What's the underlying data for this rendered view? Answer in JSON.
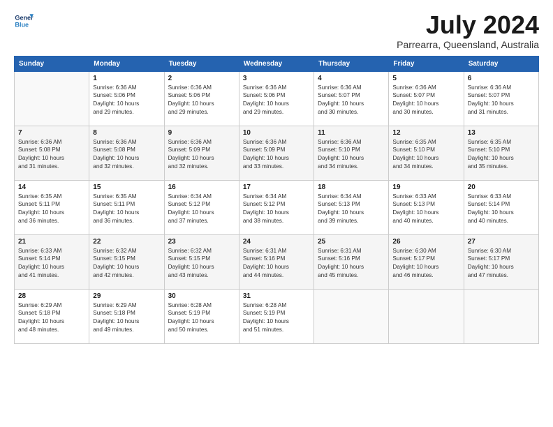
{
  "logo": {
    "line1": "General",
    "line2": "Blue"
  },
  "title": "July 2024",
  "subtitle": "Parrearra, Queensland, Australia",
  "days_header": [
    "Sunday",
    "Monday",
    "Tuesday",
    "Wednesday",
    "Thursday",
    "Friday",
    "Saturday"
  ],
  "weeks": [
    [
      {
        "day": "",
        "info": ""
      },
      {
        "day": "1",
        "info": "Sunrise: 6:36 AM\nSunset: 5:06 PM\nDaylight: 10 hours\nand 29 minutes."
      },
      {
        "day": "2",
        "info": "Sunrise: 6:36 AM\nSunset: 5:06 PM\nDaylight: 10 hours\nand 29 minutes."
      },
      {
        "day": "3",
        "info": "Sunrise: 6:36 AM\nSunset: 5:06 PM\nDaylight: 10 hours\nand 29 minutes."
      },
      {
        "day": "4",
        "info": "Sunrise: 6:36 AM\nSunset: 5:07 PM\nDaylight: 10 hours\nand 30 minutes."
      },
      {
        "day": "5",
        "info": "Sunrise: 6:36 AM\nSunset: 5:07 PM\nDaylight: 10 hours\nand 30 minutes."
      },
      {
        "day": "6",
        "info": "Sunrise: 6:36 AM\nSunset: 5:07 PM\nDaylight: 10 hours\nand 31 minutes."
      }
    ],
    [
      {
        "day": "7",
        "info": "Sunrise: 6:36 AM\nSunset: 5:08 PM\nDaylight: 10 hours\nand 31 minutes."
      },
      {
        "day": "8",
        "info": "Sunrise: 6:36 AM\nSunset: 5:08 PM\nDaylight: 10 hours\nand 32 minutes."
      },
      {
        "day": "9",
        "info": "Sunrise: 6:36 AM\nSunset: 5:09 PM\nDaylight: 10 hours\nand 32 minutes."
      },
      {
        "day": "10",
        "info": "Sunrise: 6:36 AM\nSunset: 5:09 PM\nDaylight: 10 hours\nand 33 minutes."
      },
      {
        "day": "11",
        "info": "Sunrise: 6:36 AM\nSunset: 5:10 PM\nDaylight: 10 hours\nand 34 minutes."
      },
      {
        "day": "12",
        "info": "Sunrise: 6:35 AM\nSunset: 5:10 PM\nDaylight: 10 hours\nand 34 minutes."
      },
      {
        "day": "13",
        "info": "Sunrise: 6:35 AM\nSunset: 5:10 PM\nDaylight: 10 hours\nand 35 minutes."
      }
    ],
    [
      {
        "day": "14",
        "info": "Sunrise: 6:35 AM\nSunset: 5:11 PM\nDaylight: 10 hours\nand 36 minutes."
      },
      {
        "day": "15",
        "info": "Sunrise: 6:35 AM\nSunset: 5:11 PM\nDaylight: 10 hours\nand 36 minutes."
      },
      {
        "day": "16",
        "info": "Sunrise: 6:34 AM\nSunset: 5:12 PM\nDaylight: 10 hours\nand 37 minutes."
      },
      {
        "day": "17",
        "info": "Sunrise: 6:34 AM\nSunset: 5:12 PM\nDaylight: 10 hours\nand 38 minutes."
      },
      {
        "day": "18",
        "info": "Sunrise: 6:34 AM\nSunset: 5:13 PM\nDaylight: 10 hours\nand 39 minutes."
      },
      {
        "day": "19",
        "info": "Sunrise: 6:33 AM\nSunset: 5:13 PM\nDaylight: 10 hours\nand 40 minutes."
      },
      {
        "day": "20",
        "info": "Sunrise: 6:33 AM\nSunset: 5:14 PM\nDaylight: 10 hours\nand 40 minutes."
      }
    ],
    [
      {
        "day": "21",
        "info": "Sunrise: 6:33 AM\nSunset: 5:14 PM\nDaylight: 10 hours\nand 41 minutes."
      },
      {
        "day": "22",
        "info": "Sunrise: 6:32 AM\nSunset: 5:15 PM\nDaylight: 10 hours\nand 42 minutes."
      },
      {
        "day": "23",
        "info": "Sunrise: 6:32 AM\nSunset: 5:15 PM\nDaylight: 10 hours\nand 43 minutes."
      },
      {
        "day": "24",
        "info": "Sunrise: 6:31 AM\nSunset: 5:16 PM\nDaylight: 10 hours\nand 44 minutes."
      },
      {
        "day": "25",
        "info": "Sunrise: 6:31 AM\nSunset: 5:16 PM\nDaylight: 10 hours\nand 45 minutes."
      },
      {
        "day": "26",
        "info": "Sunrise: 6:30 AM\nSunset: 5:17 PM\nDaylight: 10 hours\nand 46 minutes."
      },
      {
        "day": "27",
        "info": "Sunrise: 6:30 AM\nSunset: 5:17 PM\nDaylight: 10 hours\nand 47 minutes."
      }
    ],
    [
      {
        "day": "28",
        "info": "Sunrise: 6:29 AM\nSunset: 5:18 PM\nDaylight: 10 hours\nand 48 minutes."
      },
      {
        "day": "29",
        "info": "Sunrise: 6:29 AM\nSunset: 5:18 PM\nDaylight: 10 hours\nand 49 minutes."
      },
      {
        "day": "30",
        "info": "Sunrise: 6:28 AM\nSunset: 5:19 PM\nDaylight: 10 hours\nand 50 minutes."
      },
      {
        "day": "31",
        "info": "Sunrise: 6:28 AM\nSunset: 5:19 PM\nDaylight: 10 hours\nand 51 minutes."
      },
      {
        "day": "",
        "info": ""
      },
      {
        "day": "",
        "info": ""
      },
      {
        "day": "",
        "info": ""
      }
    ]
  ]
}
